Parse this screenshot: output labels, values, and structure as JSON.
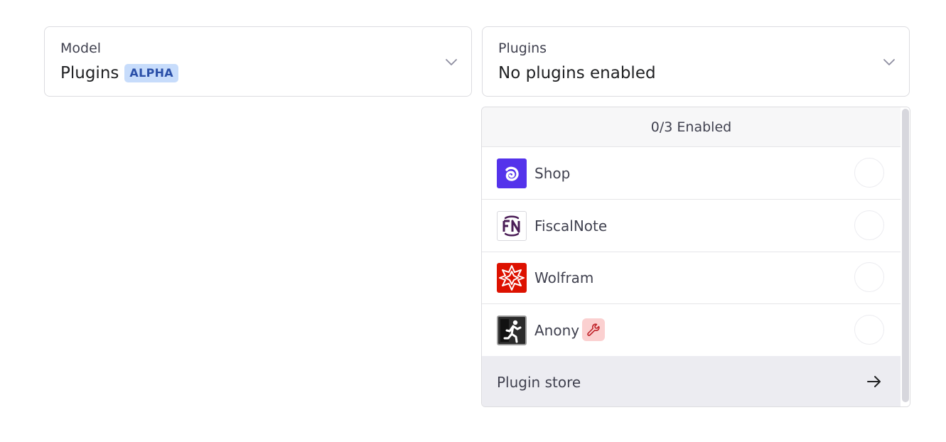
{
  "model_select": {
    "label": "Model",
    "value": "Plugins",
    "badge": "ALPHA",
    "icon": "chevron-down-icon"
  },
  "plugins_select": {
    "label": "Plugins",
    "value": "No plugins enabled",
    "icon": "chevron-down-icon"
  },
  "dropdown": {
    "header": "0/3 Enabled",
    "plugins": [
      {
        "name": "Shop",
        "icon": "shop-logo-icon",
        "color": "#5433eb",
        "enabled": false
      },
      {
        "name": "FiscalNote",
        "icon": "fiscalnote-logo-icon",
        "color": "#4b1e57",
        "enabled": false
      },
      {
        "name": "Wolfram",
        "icon": "wolfram-logo-icon",
        "color": "#dd1100",
        "enabled": false
      },
      {
        "name": "Anony",
        "icon": "running-person-icon",
        "color": "#2b2b2b",
        "enabled": false,
        "badge_icon": "wrench-icon"
      }
    ],
    "store": {
      "label": "Plugin store",
      "icon": "arrow-right-icon"
    }
  },
  "colors": {
    "alpha_badge_bg": "#c7dcfb",
    "alpha_badge_text": "#2a4fa8",
    "dev_badge_bg": "#fbd0d0",
    "dev_badge_icon": "#c0242b",
    "store_bg": "#ececf1"
  }
}
